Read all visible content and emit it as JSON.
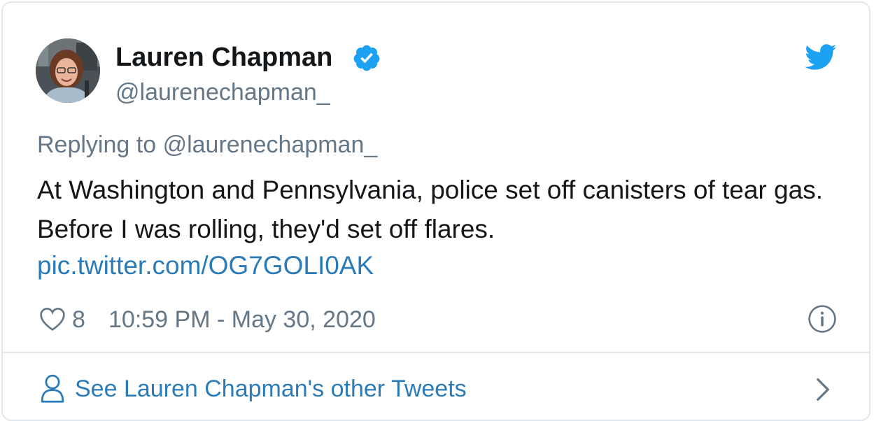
{
  "author": {
    "name": "Lauren Chapman",
    "handle": "@laurenechapman_",
    "verified": true
  },
  "reply": {
    "prefix": "Replying to",
    "handle": "@laurenechapman_"
  },
  "tweet": {
    "text": "At Washington and Pennsylvania, police set off canisters of tear gas. Before I was rolling, they'd set off flares.",
    "link": "pic.twitter.com/OG7GOLI0AK"
  },
  "meta": {
    "like_count": "8",
    "timestamp": "10:59 PM - May 30, 2020"
  },
  "footer": {
    "other_tweets_label": "See Lauren Chapman's other Tweets"
  },
  "icons": {
    "verified": "verified-badge-icon",
    "brand": "twitter-bird-icon",
    "like": "heart-icon",
    "info": "info-icon",
    "profile": "user-icon",
    "more": "chevron-right-icon"
  },
  "colors": {
    "twitter_blue": "#1da1f2",
    "link_blue": "#2b7bb9",
    "secondary_text": "#657786",
    "primary_text": "#14171a",
    "border": "#e1e8ed"
  }
}
